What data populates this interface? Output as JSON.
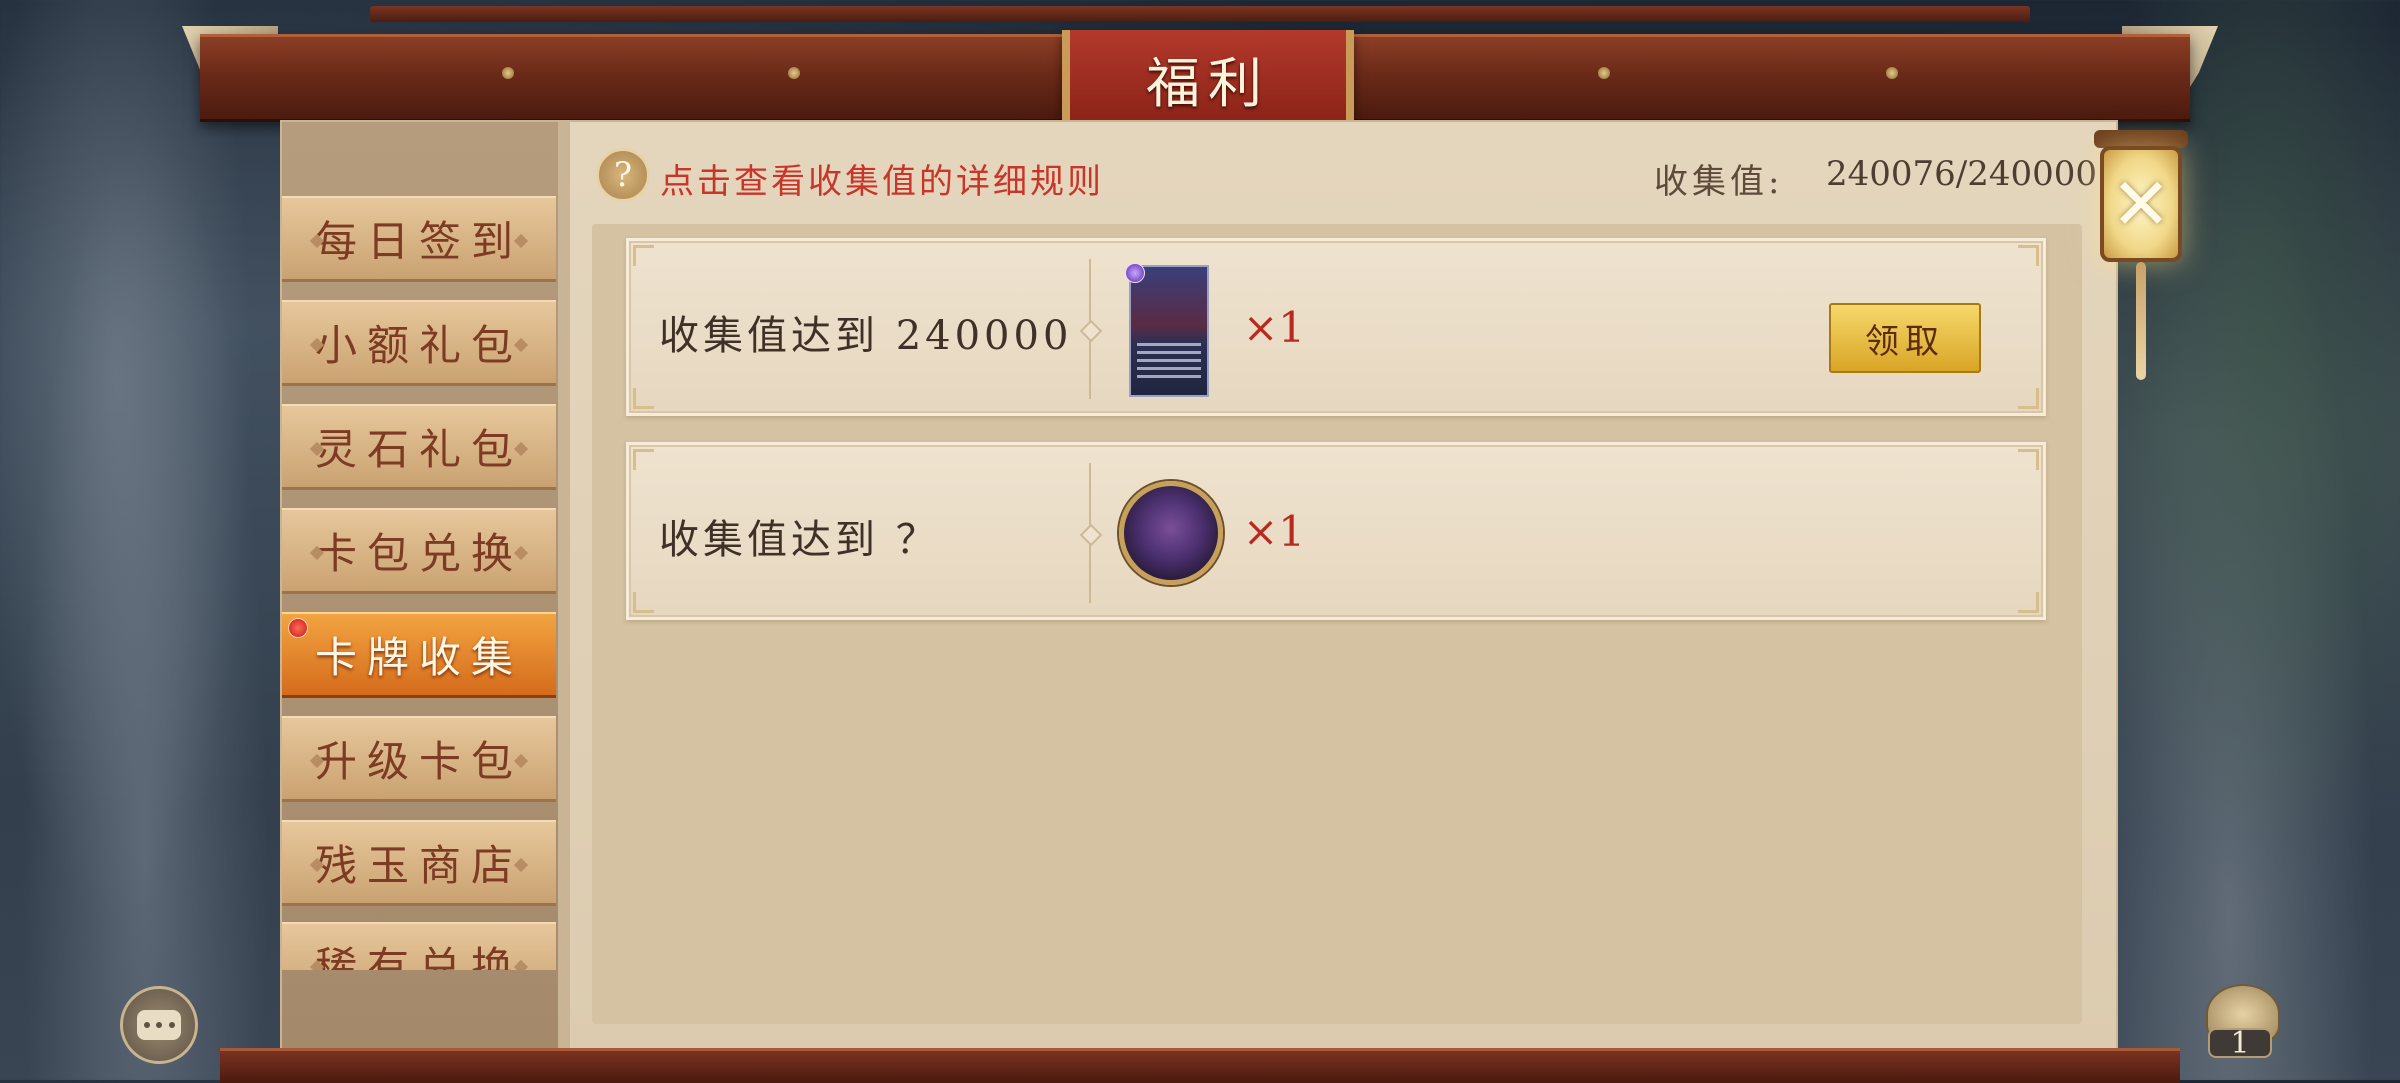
{
  "title": "福利",
  "help": {
    "icon": "?",
    "text": "点击查看收集值的详细规则"
  },
  "collection": {
    "label": "收集值:",
    "value": "240076/240000"
  },
  "sidebar": {
    "items": [
      {
        "label": "每日签到"
      },
      {
        "label": "小额礼包"
      },
      {
        "label": "灵石礼包"
      },
      {
        "label": "卡包兑换"
      },
      {
        "label": "卡牌收集",
        "active": true,
        "badge": "red-dot"
      },
      {
        "label": "升级卡包"
      },
      {
        "label": "残玉商店"
      },
      {
        "label": "稀有兑换"
      }
    ]
  },
  "rewards": [
    {
      "label": "收集值达到 240000",
      "item_icon": "hero-card",
      "quantity": "×1",
      "claim_label": "领取"
    },
    {
      "label": "收集值达到 ？",
      "item_icon": "avatar-frame-coin",
      "quantity": "×1"
    }
  ],
  "close": {
    "icon": "close-x-lantern",
    "glyph": "✕"
  },
  "bottom": {
    "chat_icon": "chat-bubble-icon",
    "bag_icon": "bag-icon",
    "bag_count": "1"
  },
  "colors": {
    "accent_red": "#c8362a",
    "active_tab": "#e07d25",
    "claim_button": "#e9c047",
    "qty_red": "#b72a1f"
  }
}
